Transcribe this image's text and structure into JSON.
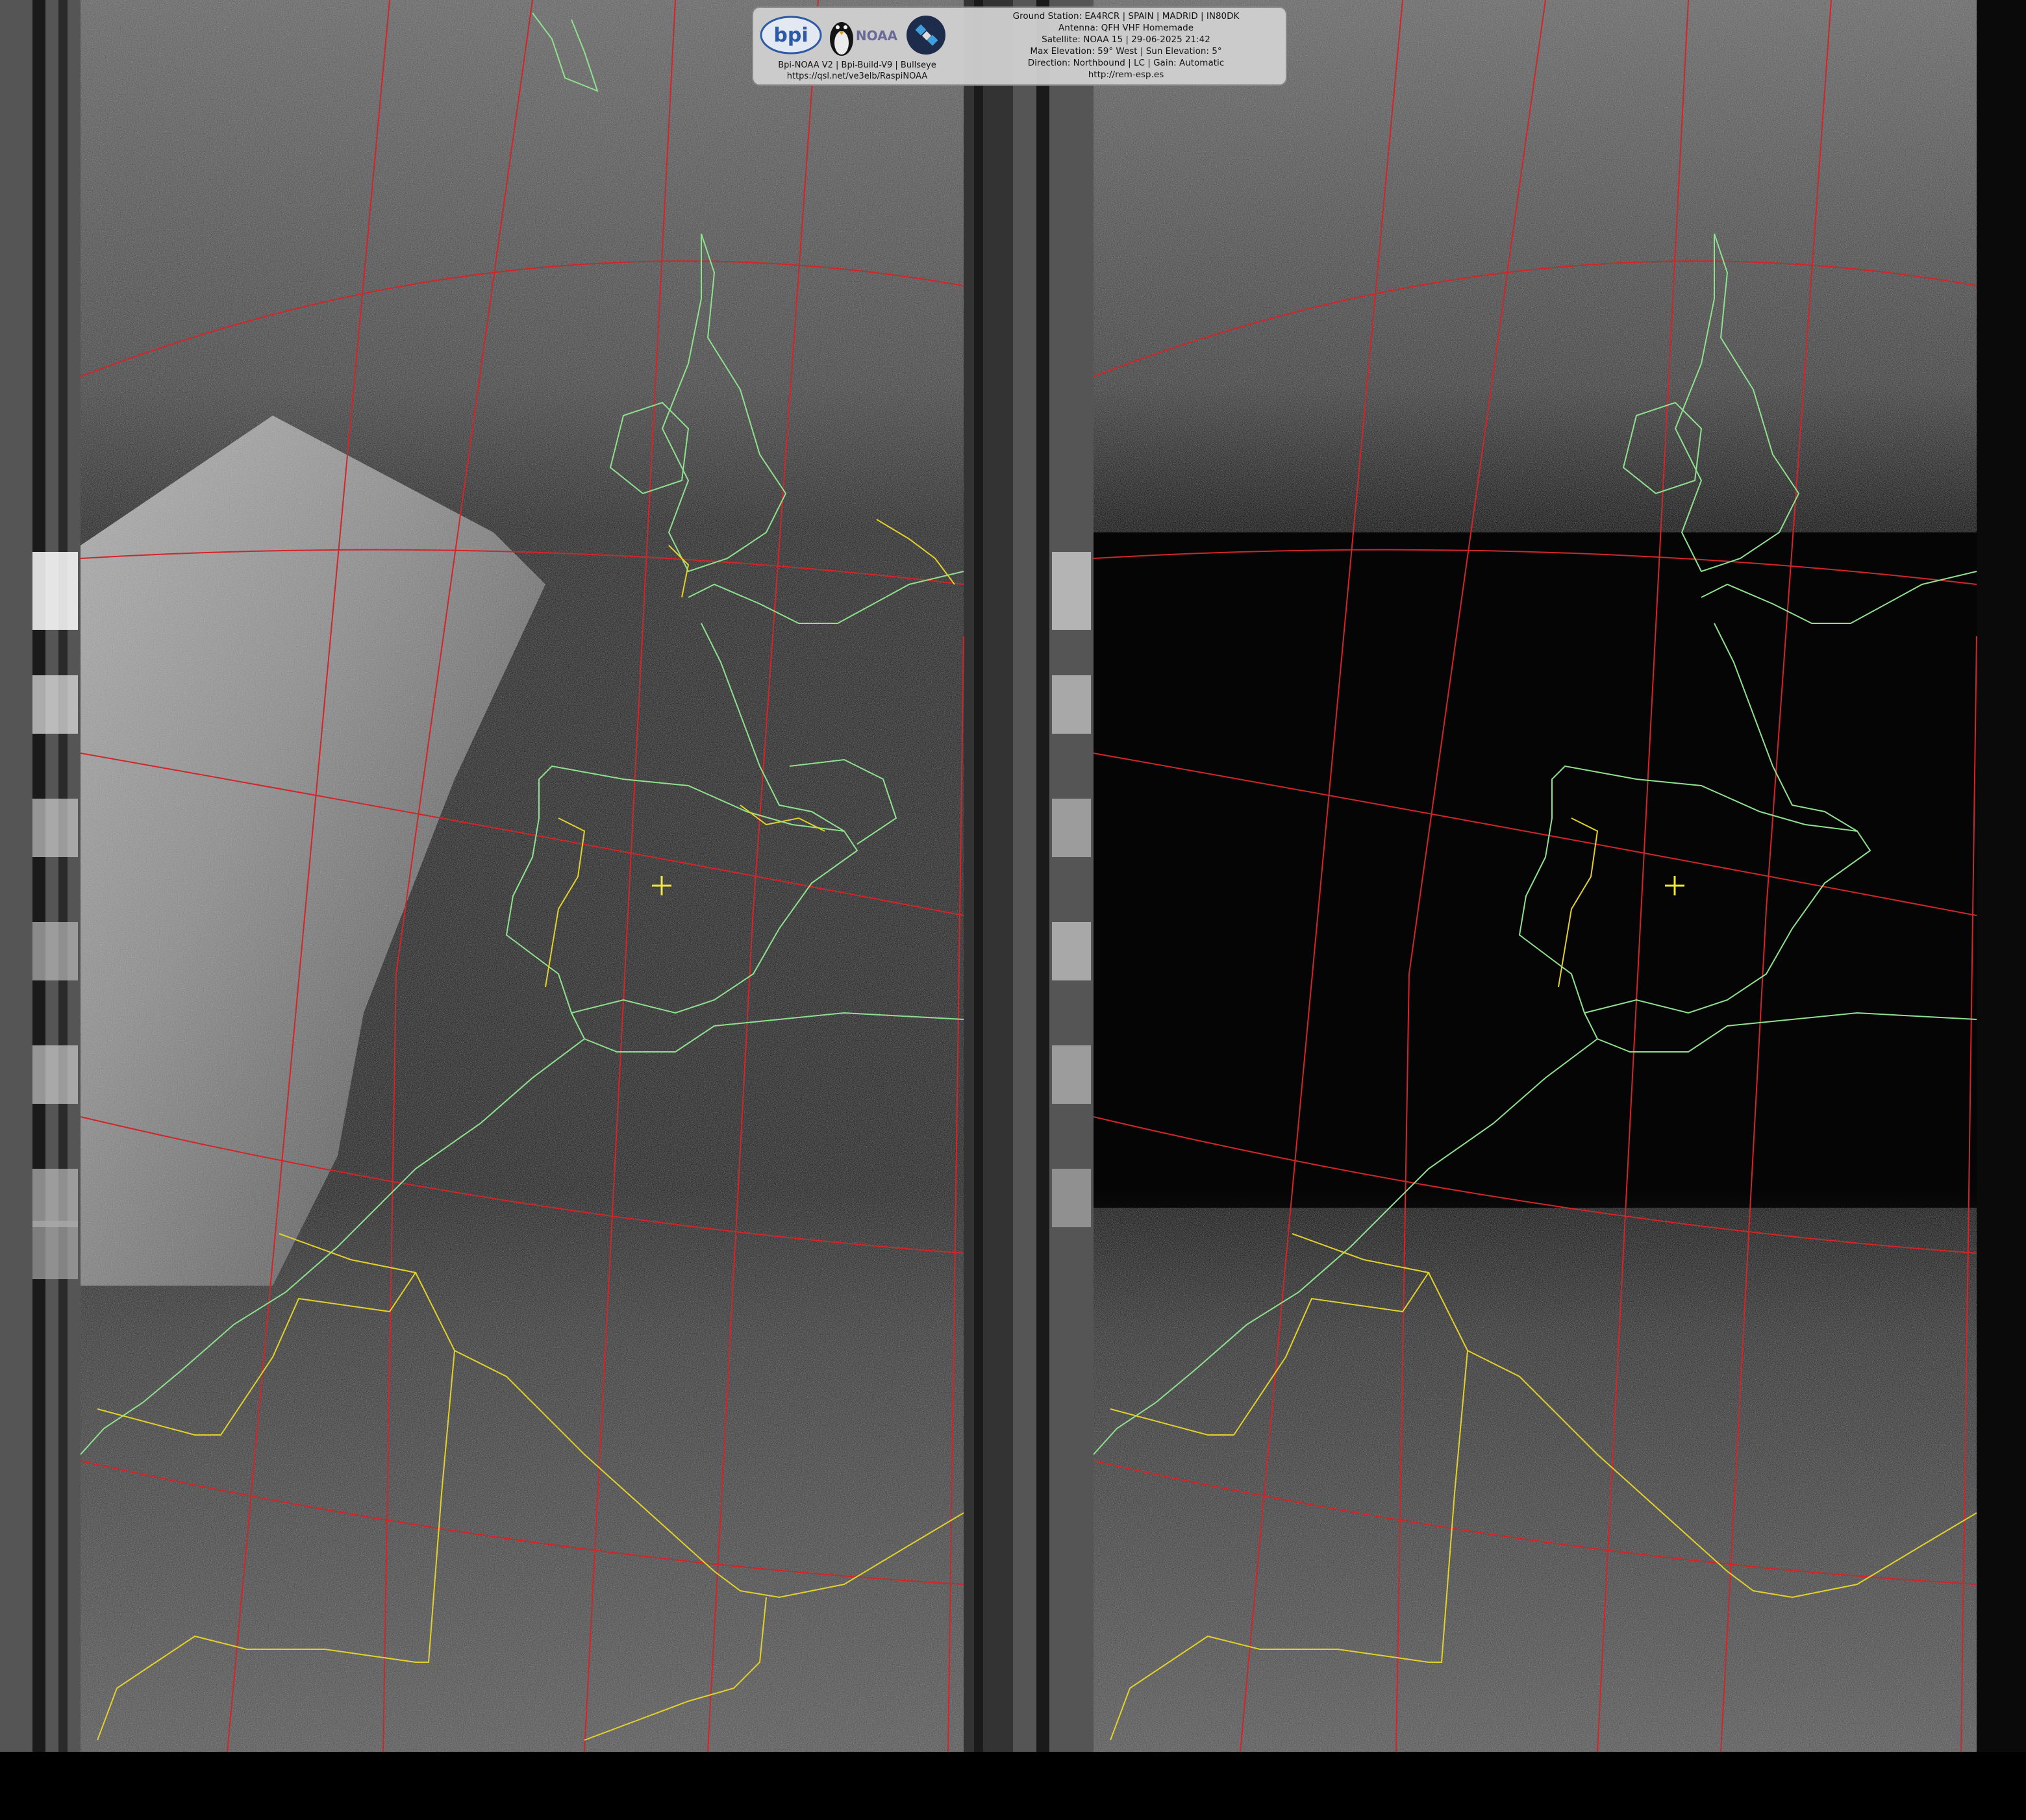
{
  "header": {
    "left_lines": [
      "Bpi-NOAA V2 | Bpi-Build-V9 | Bullseye",
      "https://qsl.net/ve3elb/RaspiNOAA"
    ],
    "right_lines": [
      "Ground Station: EA4RCR | SPAIN | MADRID | IN80DK",
      "Antenna: QFH VHF Homemade",
      "Satellite: NOAA 15 | 29-06-2025 21:42",
      "Max Elevation: 59° West | Sun Elevation: 5°",
      "Direction: Northbound | LC | Gain: Automatic",
      "http://rem-esp.es"
    ],
    "logo_bpi_text": "bpi",
    "logo_noaa_text": "NOAA",
    "logos": [
      "bpi-logo",
      "linux-penguin-icon",
      "noaa-logo",
      "satellite-logo-icon"
    ]
  },
  "panels": [
    {
      "name": "visible-channel-panel",
      "description_color": "#1a1a1a"
    },
    {
      "name": "infrared-channel-panel",
      "description_color": "#050505"
    }
  ],
  "colors": {
    "graticule": "#d0262a",
    "coastline": "#8fe08f",
    "border": "#e2d12a",
    "marker": "#f2e63c",
    "noise_bright": "#8a8a8a",
    "background": "#000000"
  }
}
